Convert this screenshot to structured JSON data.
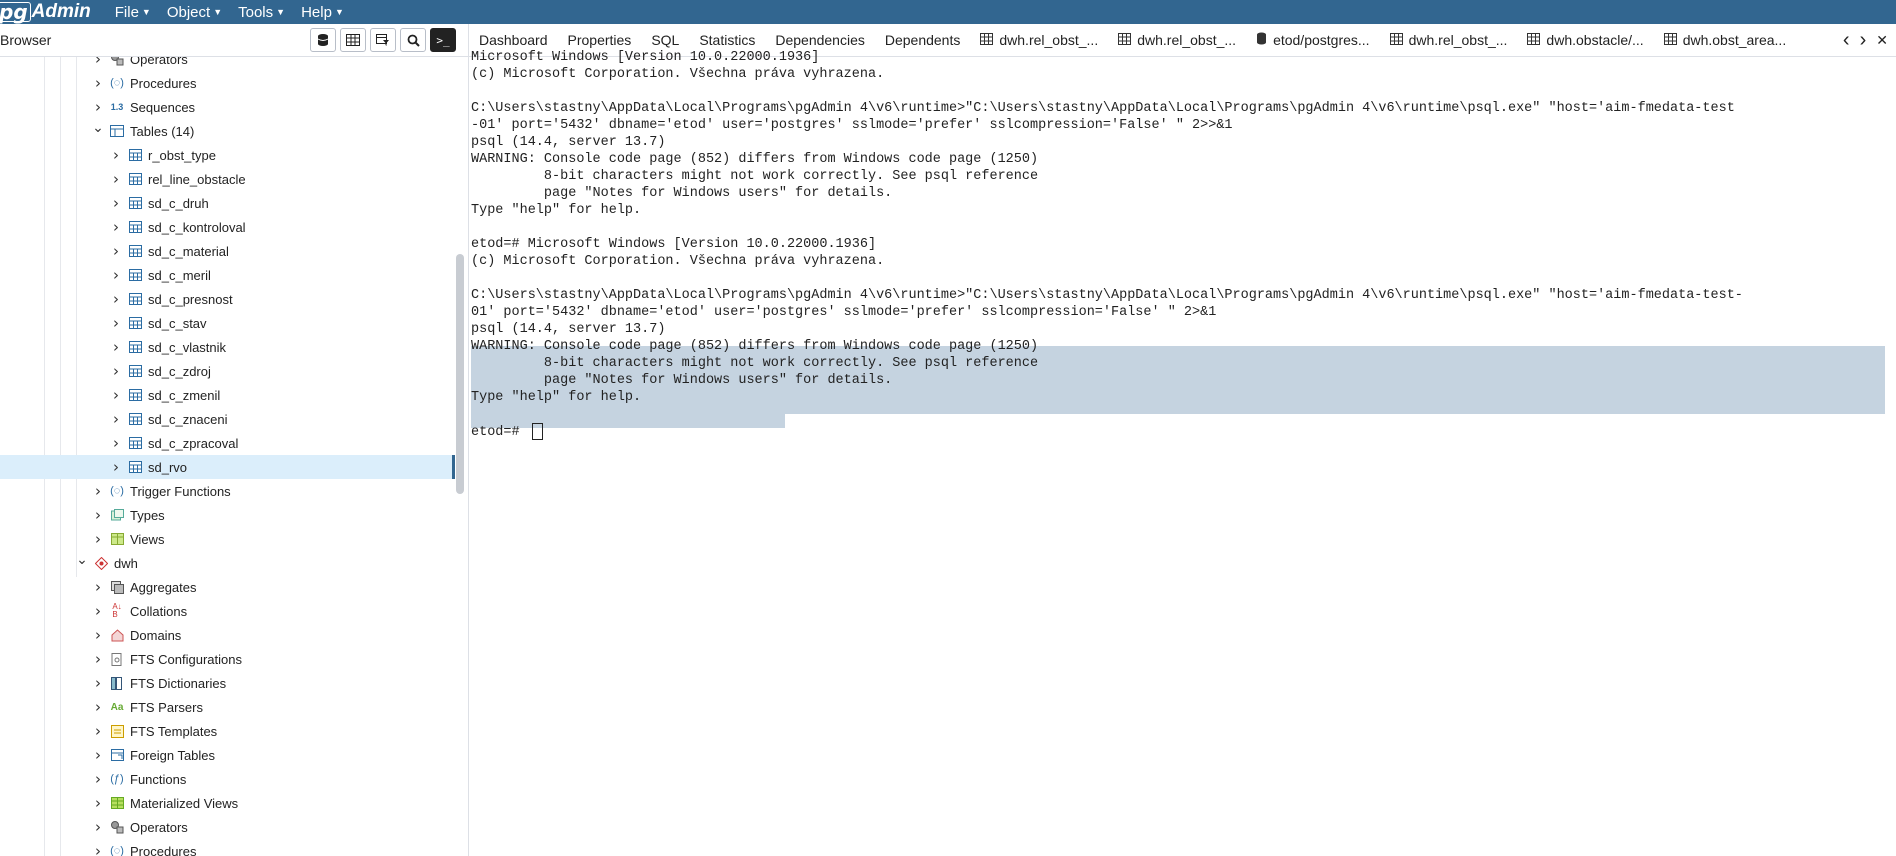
{
  "menubar": {
    "logo_pg": "pg",
    "logo_text": "Admin",
    "items": [
      {
        "label": "File"
      },
      {
        "label": "Object"
      },
      {
        "label": "Tools"
      },
      {
        "label": "Help"
      }
    ],
    "colors": {
      "bar": "#326690"
    }
  },
  "browser": {
    "title": "Browser",
    "toolbar_icons": [
      "database-icon",
      "table-grid-icon",
      "filter-table-icon",
      "search-icon",
      "terminal-icon"
    ],
    "tree": [
      {
        "label": "Operators",
        "level": 1,
        "icon": "operator-icon",
        "expanded": false
      },
      {
        "label": "Procedures",
        "level": 1,
        "icon": "procedure-icon",
        "expanded": false
      },
      {
        "label": "Sequences",
        "level": 1,
        "icon": "sequence-icon",
        "expanded": false
      },
      {
        "label": "Tables (14)",
        "level": 1,
        "icon": "tables-icon",
        "expanded": true
      },
      {
        "label": "r_obst_type",
        "level": 2,
        "icon": "table-icon",
        "expanded": false
      },
      {
        "label": "rel_line_obstacle",
        "level": 2,
        "icon": "table-icon",
        "expanded": false
      },
      {
        "label": "sd_c_druh",
        "level": 2,
        "icon": "table-icon",
        "expanded": false
      },
      {
        "label": "sd_c_kontroloval",
        "level": 2,
        "icon": "table-icon",
        "expanded": false
      },
      {
        "label": "sd_c_material",
        "level": 2,
        "icon": "table-icon",
        "expanded": false
      },
      {
        "label": "sd_c_meril",
        "level": 2,
        "icon": "table-icon",
        "expanded": false
      },
      {
        "label": "sd_c_presnost",
        "level": 2,
        "icon": "table-icon",
        "expanded": false
      },
      {
        "label": "sd_c_stav",
        "level": 2,
        "icon": "table-icon",
        "expanded": false
      },
      {
        "label": "sd_c_vlastnik",
        "level": 2,
        "icon": "table-icon",
        "expanded": false
      },
      {
        "label": "sd_c_zdroj",
        "level": 2,
        "icon": "table-icon",
        "expanded": false
      },
      {
        "label": "sd_c_zmenil",
        "level": 2,
        "icon": "table-icon",
        "expanded": false
      },
      {
        "label": "sd_c_znaceni",
        "level": 2,
        "icon": "table-icon",
        "expanded": false
      },
      {
        "label": "sd_c_zpracoval",
        "level": 2,
        "icon": "table-icon",
        "expanded": false
      },
      {
        "label": "sd_rvo",
        "level": 2,
        "icon": "table-icon",
        "expanded": false,
        "selected": true
      },
      {
        "label": "Trigger Functions",
        "level": 1,
        "icon": "trigger-function-icon",
        "expanded": false
      },
      {
        "label": "Types",
        "level": 1,
        "icon": "type-icon",
        "expanded": false
      },
      {
        "label": "Views",
        "level": 1,
        "icon": "view-icon",
        "expanded": false
      },
      {
        "label": "dwh",
        "level": 0,
        "icon": "schema-icon",
        "expanded": true
      },
      {
        "label": "Aggregates",
        "level": 1,
        "icon": "aggregate-icon",
        "expanded": false
      },
      {
        "label": "Collations",
        "level": 1,
        "icon": "collation-icon",
        "expanded": false
      },
      {
        "label": "Domains",
        "level": 1,
        "icon": "domain-icon",
        "expanded": false
      },
      {
        "label": "FTS Configurations",
        "level": 1,
        "icon": "fts-configuration-icon",
        "expanded": false
      },
      {
        "label": "FTS Dictionaries",
        "level": 1,
        "icon": "fts-dictionary-icon",
        "expanded": false
      },
      {
        "label": "FTS Parsers",
        "level": 1,
        "icon": "fts-parser-icon",
        "expanded": false
      },
      {
        "label": "FTS Templates",
        "level": 1,
        "icon": "fts-template-icon",
        "expanded": false
      },
      {
        "label": "Foreign Tables",
        "level": 1,
        "icon": "foreign-table-icon",
        "expanded": false
      },
      {
        "label": "Functions",
        "level": 1,
        "icon": "function-icon",
        "expanded": false
      },
      {
        "label": "Materialized Views",
        "level": 1,
        "icon": "materialized-view-icon",
        "expanded": false
      },
      {
        "label": "Operators",
        "level": 1,
        "icon": "operator-icon",
        "expanded": false
      },
      {
        "label": "Procedures",
        "level": 1,
        "icon": "procedure-icon",
        "expanded": false
      }
    ]
  },
  "tabs": [
    {
      "label": "Dashboard",
      "icon": ""
    },
    {
      "label": "Properties",
      "icon": ""
    },
    {
      "label": "SQL",
      "icon": ""
    },
    {
      "label": "Statistics",
      "icon": ""
    },
    {
      "label": "Dependencies",
      "icon": ""
    },
    {
      "label": "Dependents",
      "icon": ""
    },
    {
      "label": "dwh.rel_obst_...",
      "icon": "table-icon"
    },
    {
      "label": "dwh.rel_obst_...",
      "icon": "table-icon"
    },
    {
      "label": "etod/postgres...",
      "icon": "psql-icon"
    },
    {
      "label": "dwh.rel_obst_...",
      "icon": "table-icon"
    },
    {
      "label": "dwh.obstacle/...",
      "icon": "table-icon"
    },
    {
      "label": "dwh.obst_area...",
      "icon": "table-icon"
    }
  ],
  "console": {
    "lines": [
      "Microsoft Windows [Version 10.0.22000.1936]",
      "(c) Microsoft Corporation. Všechna práva vyhrazena.",
      "",
      "C:\\Users\\stastny\\AppData\\Local\\Programs\\pgAdmin 4\\v6\\runtime>\"C:\\Users\\stastny\\AppData\\Local\\Programs\\pgAdmin 4\\v6\\runtime\\psql.exe\" \"host='aim-fmedata-test",
      "-01' port='5432' dbname='etod' user='postgres' sslmode='prefer' sslcompression='False' \" 2>>&1",
      "psql (14.4, server 13.7)",
      "WARNING: Console code page (852) differs from Windows code page (1250)",
      "         8-bit characters might not work correctly. See psql reference",
      "         page \"Notes for Windows users\" for details.",
      "Type \"help\" for help.",
      "",
      "etod=# Microsoft Windows [Version 10.0.22000.1936]",
      "(c) Microsoft Corporation. Všechna práva vyhrazena.",
      "",
      "C:\\Users\\stastny\\AppData\\Local\\Programs\\pgAdmin 4\\v6\\runtime>\"C:\\Users\\stastny\\AppData\\Local\\Programs\\pgAdmin 4\\v6\\runtime\\psql.exe\" \"host='aim-fmedata-test-",
      "01' port='5432' dbname='etod' user='postgres' sslmode='prefer' sslcompression='False' \" 2>&1",
      "psql (14.4, server 13.7)",
      "WARNING: Console code page (852) differs from Windows code page (1250)",
      "         8-bit characters might not work correctly. See psql reference",
      "         page \"Notes for Windows users\" for details.",
      "Type \"help\" for help.",
      "",
      "etod=# "
    ],
    "selection_color": "#c5d3e0"
  }
}
